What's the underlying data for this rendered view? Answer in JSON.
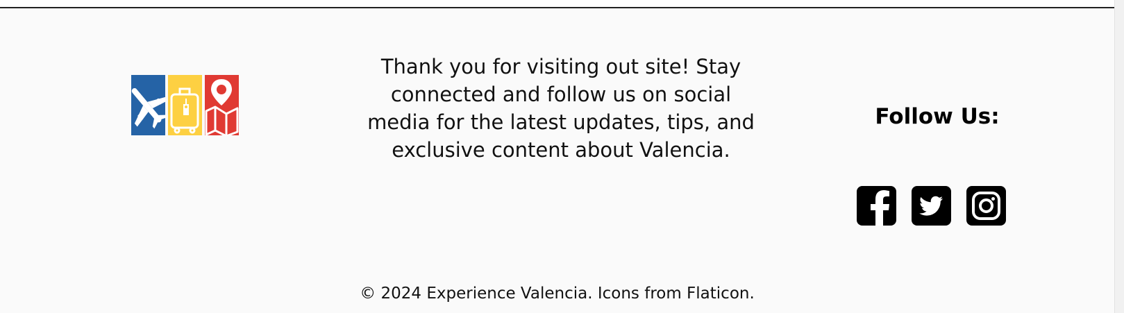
{
  "footer": {
    "message": "Thank you for visiting out site! Stay connected and follow us on social media for the latest updates, tips, and exclusive content about Valencia.",
    "follow_heading": "Follow Us:",
    "copyright": "© 2024 Experience Valencia. Icons from Flaticon.",
    "logo": {
      "panels": [
        {
          "icon": "airplane-icon",
          "color": "#2563a6"
        },
        {
          "icon": "suitcase-icon",
          "color": "#fdd042"
        },
        {
          "icon": "map-pin-icon",
          "color": "#e03a33"
        }
      ]
    },
    "socials": [
      {
        "icon": "facebook-icon"
      },
      {
        "icon": "twitter-icon"
      },
      {
        "icon": "instagram-icon"
      }
    ]
  }
}
